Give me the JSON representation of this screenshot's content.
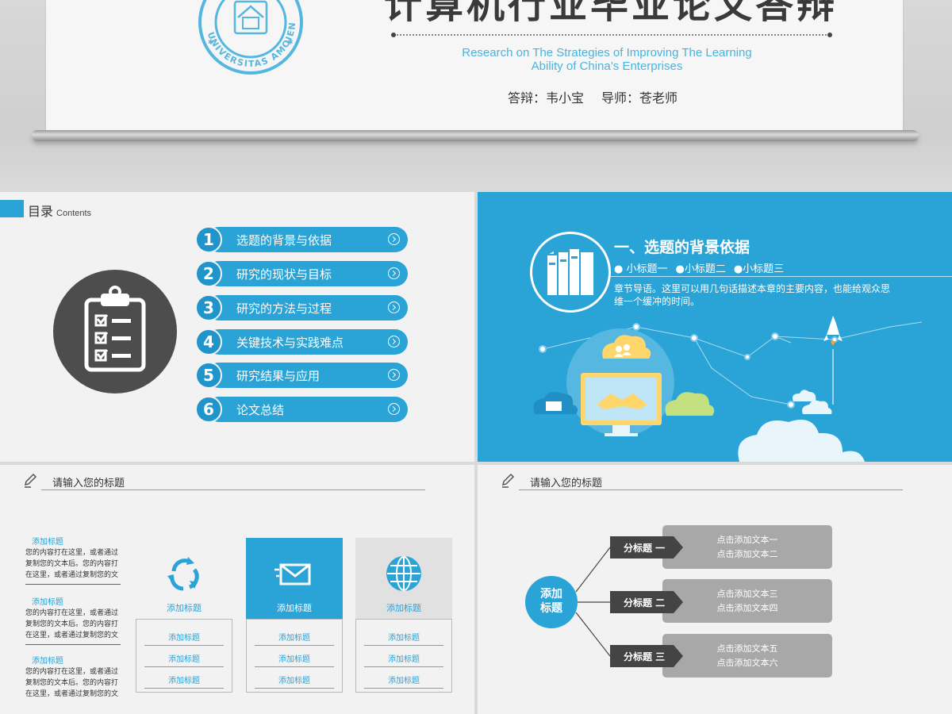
{
  "cover": {
    "title": "计算机行业毕业论文答辩",
    "subtitle_line1": "Research on The Strategies of Improving The Learning",
    "subtitle_line2": "Ability of China’s Enterprises",
    "defender": "答辩：韦小宝",
    "advisor": "导师：苍老师",
    "seal_text": "UNIVERSITAS AMOIENSIS",
    "colors": {
      "accent": "#4ab3dd",
      "title": "#3a3a3a"
    }
  },
  "toc": {
    "heading": "目录",
    "heading_en": "Contents",
    "icon": "clipboard-checklist-icon",
    "items": [
      {
        "num": "1",
        "label": "选题的背景与依据"
      },
      {
        "num": "2",
        "label": "研究的现状与目标"
      },
      {
        "num": "3",
        "label": "研究的方法与过程"
      },
      {
        "num": "4",
        "label": "关键技术与实践难点"
      },
      {
        "num": "5",
        "label": "研究结果与应用"
      },
      {
        "num": "6",
        "label": "论文总结"
      }
    ],
    "colors": {
      "accent": "#2aa3d7",
      "dark": "#4d4d4d"
    }
  },
  "chapter": {
    "title": "一、选题的背景依据",
    "subtitles": [
      "● 小标题一",
      "●小标题二",
      "●小标题三"
    ],
    "guide": "章节导语。这里可以用几句话描述本章的主要内容，也能给观众思维一个缓冲的时间。",
    "icons": [
      "books-icon",
      "cloud-people-icon",
      "chat-cloud-icon",
      "monitor-handshake-icon",
      "rocket-icon"
    ],
    "colors": {
      "background": "#2aa3d7"
    }
  },
  "boxes": {
    "heading": "请输入您的标题",
    "notes": [
      {
        "title": "添加标题",
        "body": "您的内容打在这里，或者通过复制您的文本后。您的内容打在这里，或者通过复制您的文"
      },
      {
        "title": "添加标题",
        "body": "您的内容打在这里，或者通过复制您的文本后。您的内容打在这里，或者通过复制您的文"
      },
      {
        "title": "添加标题",
        "body": "您的内容打在这里，或者通过复制您的文本后。您的内容打在这里，或者通过复制您的文"
      }
    ],
    "columns": [
      {
        "label": "添加标题",
        "icon": "recycle-icon",
        "rows": [
          "添加标题",
          "添加标题",
          "添加标题"
        ]
      },
      {
        "label": "添加标题",
        "icon": "envelope-icon",
        "rows": [
          "添加标题",
          "添加标题",
          "添加标题"
        ]
      },
      {
        "label": "添加标题",
        "icon": "globe-icon",
        "rows": [
          "添加标题",
          "添加标题",
          "添加标题"
        ]
      }
    ]
  },
  "tree": {
    "heading": "请输入您的标题",
    "root": [
      "添加",
      "标题"
    ],
    "branches": [
      {
        "label": "分标题 一",
        "lines": [
          "点击添加文本一",
          "点击添加文本二"
        ]
      },
      {
        "label": "分标题 二",
        "lines": [
          "点击添加文本三",
          "点击添加文本四"
        ]
      },
      {
        "label": "分标题 三",
        "lines": [
          "点击添加文本五",
          "点击添加文本六"
        ]
      }
    ]
  }
}
